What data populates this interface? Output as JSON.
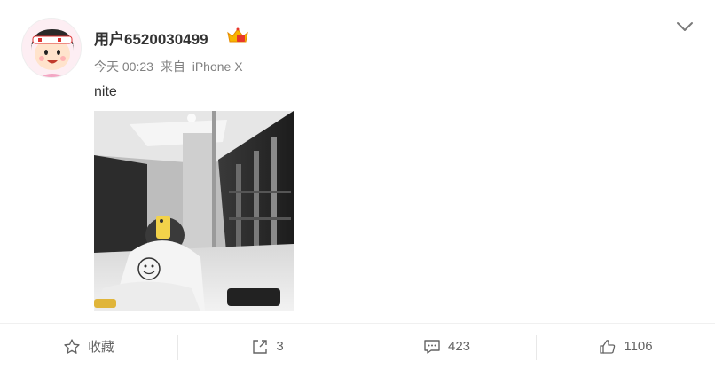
{
  "post": {
    "username": "用户6520030499",
    "time": "今天 00:23",
    "source_prefix": "来自",
    "source": "iPhone X",
    "text": "nite"
  },
  "toolbar": {
    "favorite_label": "收藏",
    "repost_count": "3",
    "comment_count": "423",
    "like_count": "1106"
  },
  "icons": {
    "menu": "chevron-down-icon",
    "favorite": "star-icon",
    "repost": "share-icon",
    "comment": "comment-icon",
    "like": "thumbs-up-icon",
    "badge": "vip-crown-icon"
  },
  "colors": {
    "text": "#333333",
    "muted": "#808080",
    "toolbar_text": "#636363",
    "badge": "#f7b500"
  }
}
